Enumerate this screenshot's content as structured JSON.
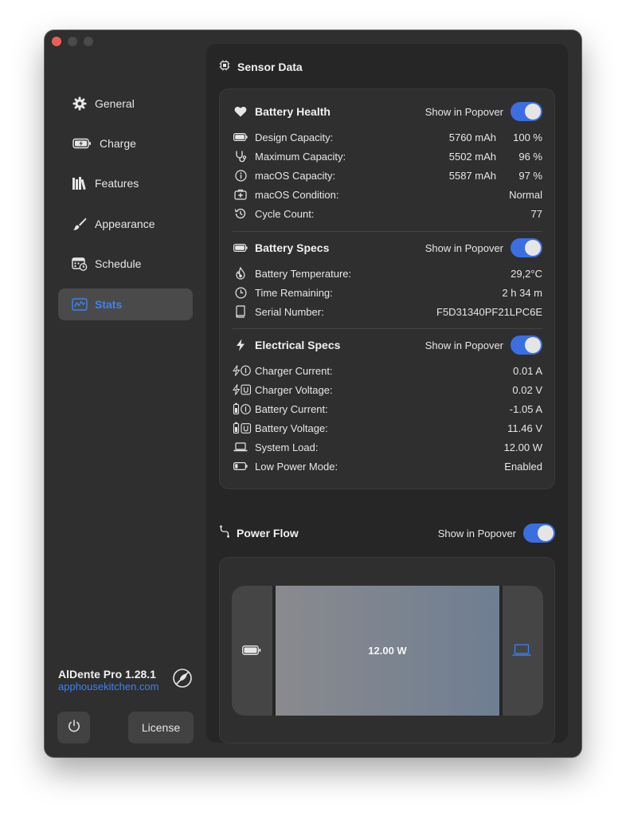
{
  "sidebar": {
    "items": [
      {
        "label": "General",
        "icon": "gear-icon"
      },
      {
        "label": "Charge",
        "icon": "battery-charging-icon"
      },
      {
        "label": "Features",
        "icon": "books-icon"
      },
      {
        "label": "Appearance",
        "icon": "paintbrush-icon"
      },
      {
        "label": "Schedule",
        "icon": "calendar-clock-icon"
      },
      {
        "label": "Stats",
        "icon": "chart-icon",
        "active": true
      }
    ],
    "app_name": "AlDente Pro 1.28.1",
    "app_link": "apphousekitchen.com",
    "license_label": "License"
  },
  "sensor": {
    "title": "Sensor Data",
    "popover_label": "Show in Popover",
    "battery_health": {
      "title": "Battery Health",
      "rows": [
        {
          "label": "Design Capacity:",
          "value": "5760 mAh",
          "percent": "100 %"
        },
        {
          "label": "Maximum Capacity:",
          "value": "5502 mAh",
          "percent": "96 %"
        },
        {
          "label": "macOS Capacity:",
          "value": "5587 mAh",
          "percent": "97 %"
        },
        {
          "label": "macOS Condition:",
          "value": "Normal"
        },
        {
          "label": "Cycle Count:",
          "value": "77"
        }
      ]
    },
    "battery_specs": {
      "title": "Battery Specs",
      "rows": [
        {
          "label": "Battery Temperature:",
          "value": "29,2°C"
        },
        {
          "label": "Time Remaining:",
          "value": "2 h 34 m"
        },
        {
          "label": "Serial Number:",
          "value": "F5D31340PF21LPC6E"
        }
      ]
    },
    "electrical_specs": {
      "title": "Electrical Specs",
      "rows": [
        {
          "label": "Charger Current:",
          "value": "0.01 A"
        },
        {
          "label": "Charger Voltage:",
          "value": "0.02 V"
        },
        {
          "label": "Battery Current:",
          "value": "-1.05 A"
        },
        {
          "label": "Battery Voltage:",
          "value": "11.46 V"
        },
        {
          "label": "System Load:",
          "value": "12.00 W"
        },
        {
          "label": "Low Power Mode:",
          "value": "Enabled"
        }
      ]
    }
  },
  "power_flow": {
    "title": "Power Flow",
    "popover_label": "Show in Popover",
    "value": "12.00 W"
  },
  "colors": {
    "accent": "#3b82f6",
    "toggle_on": "#3b6fe0",
    "window_bg": "#2f2f2f",
    "panel_bg": "#262626"
  }
}
